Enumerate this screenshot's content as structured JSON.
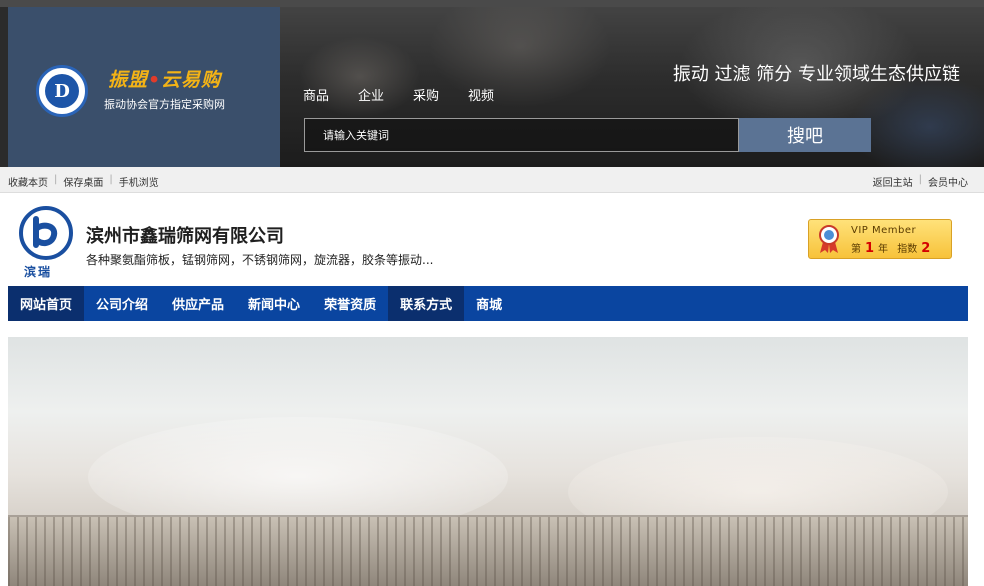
{
  "header": {
    "logo_text": "D",
    "brand_title_part1": "振盟",
    "brand_title_dot": "•",
    "brand_title_part2": "云易购",
    "brand_subtitle": "振动协会官方指定采购网",
    "nav": [
      "商品",
      "企业",
      "采购",
      "视频"
    ],
    "slogan": "振动 过滤 筛分 专业领域生态供应链",
    "search_placeholder": "请输入关键词",
    "search_button": "搜吧"
  },
  "toolbar": {
    "left": [
      "收藏本页",
      "保存桌面",
      "手机浏览"
    ],
    "right": [
      "返回主站",
      "会员中心"
    ],
    "separator": "|"
  },
  "company": {
    "logo_label": "滨瑞",
    "name": "滨州市鑫瑞筛网有限公司",
    "description": "各种聚氨酯筛板，锰钢筛网，不锈钢筛网，旋流器，胶条等振动...",
    "vip": {
      "title": "VIP Member",
      "prefix": "第",
      "years": "1",
      "year_unit": "年",
      "index_label": "指数",
      "index_value": "2"
    }
  },
  "main_nav": {
    "items": [
      "网站首页",
      "公司介绍",
      "供应产品",
      "新闻中心",
      "荣誉资质",
      "联系方式",
      "商城"
    ],
    "active": [
      "网站首页",
      "联系方式"
    ]
  },
  "colors": {
    "nav_blue": "#0a45a0",
    "nav_active": "#0b2f6e",
    "brand_gold": "#f3b316",
    "search_button": "#5b7394"
  }
}
